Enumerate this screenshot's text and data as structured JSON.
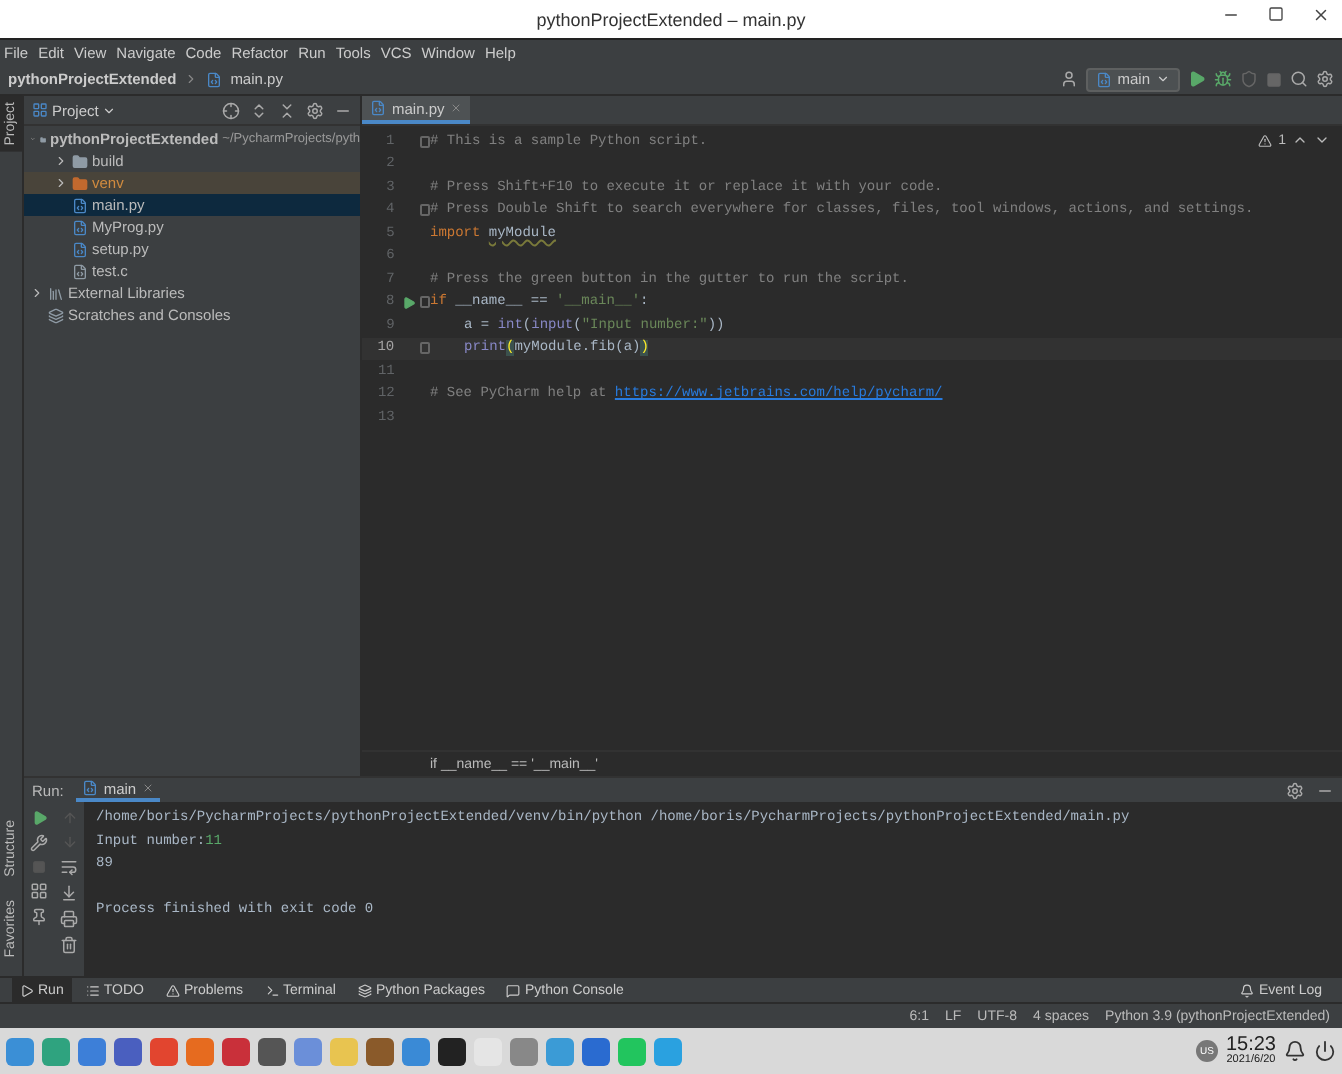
{
  "window": {
    "title": "pythonProjectExtended – main.py"
  },
  "menu": [
    "File",
    "Edit",
    "View",
    "Navigate",
    "Code",
    "Refactor",
    "Run",
    "Tools",
    "VCS",
    "Window",
    "Help"
  ],
  "breadcrumb": [
    "pythonProjectExtended",
    "main.py"
  ],
  "run_config": {
    "label": "main"
  },
  "stripe_top": [
    {
      "label": "Project",
      "selected": true
    }
  ],
  "stripe_bottom": [
    {
      "label": "Structure",
      "selected": false
    },
    {
      "label": "Favorites",
      "selected": false
    }
  ],
  "project_panel": {
    "title": "Project",
    "tree": [
      {
        "label": "pythonProjectExtended",
        "path": "~/PycharmProjects/pyth",
        "kind": "folder",
        "expanded": true,
        "selected": false,
        "children": [
          {
            "label": "build",
            "kind": "folder",
            "expanded": false,
            "selected": false
          },
          {
            "label": "venv",
            "kind": "excluded",
            "expanded": false,
            "selected": false
          },
          {
            "label": "main.py",
            "kind": "python",
            "selected": true
          },
          {
            "label": "MyProg.py",
            "kind": "python",
            "selected": false
          },
          {
            "label": "setup.py",
            "kind": "python",
            "selected": false
          },
          {
            "label": "test.c",
            "kind": "c",
            "selected": false
          }
        ]
      },
      {
        "label": "External Libraries",
        "kind": "libraries",
        "expanded": false,
        "selected": false
      },
      {
        "label": "Scratches and Consoles",
        "kind": "scratches",
        "selected": false
      }
    ]
  },
  "editor": {
    "tabs": [
      {
        "label": "main.py",
        "selected": true
      }
    ],
    "warnings": "1",
    "breadcrumb": "if __name__ == '__main__'",
    "lines": [
      {
        "number": "1",
        "fold": true,
        "run": false,
        "current": false,
        "indented": false,
        "tokens": [
          {
            "text": "# This is a sample Python script.",
            "kind": "comment"
          }
        ]
      },
      {
        "number": "2",
        "fold": false,
        "run": false,
        "current": false
      },
      {
        "number": "3",
        "fold": false,
        "run": false,
        "current": false,
        "indented": false,
        "tokens": [
          {
            "text": "# Press Shift+F10 to execute it or replace it with your code.",
            "kind": "comment"
          }
        ]
      },
      {
        "number": "4",
        "fold": true,
        "run": false,
        "current": false,
        "indented": false,
        "tokens": [
          {
            "text": "# Press Double Shift to search everywhere for classes, files, tool windows, actions, and settings.",
            "kind": "comment"
          }
        ]
      },
      {
        "number": "5",
        "fold": false,
        "run": false,
        "current": false,
        "indented": false,
        "tokens": [
          {
            "text": "import ",
            "kind": "keyword"
          },
          {
            "text": "myModule",
            "kind": "module"
          }
        ]
      },
      {
        "number": "6",
        "fold": false,
        "run": false,
        "current": false
      },
      {
        "number": "7",
        "fold": false,
        "run": false,
        "current": false,
        "indented": false,
        "tokens": [
          {
            "text": "# Press the green button in the gutter to run the script.",
            "kind": "comment"
          }
        ]
      },
      {
        "number": "8",
        "fold": true,
        "run": true,
        "current": false,
        "indented": false,
        "tokens": [
          {
            "text": "if ",
            "kind": "keyword"
          },
          {
            "text": "__name__ == ",
            "kind": "plain"
          },
          {
            "text": "'__main__'",
            "kind": "string"
          },
          {
            "text": ":",
            "kind": "plain"
          }
        ]
      },
      {
        "number": "9",
        "fold": false,
        "run": false,
        "current": false,
        "indented": true,
        "tokens": [
          {
            "text": "a = ",
            "kind": "plain"
          },
          {
            "text": "int",
            "kind": "builtin"
          },
          {
            "text": "(",
            "kind": "plain"
          },
          {
            "text": "input",
            "kind": "builtin"
          },
          {
            "text": "(",
            "kind": "plain"
          },
          {
            "text": "\"Input number:\"",
            "kind": "string"
          },
          {
            "text": "))",
            "kind": "plain"
          }
        ]
      },
      {
        "number": "10",
        "fold": true,
        "run": false,
        "current": true,
        "indented": true,
        "tokens": [
          {
            "text": "print",
            "kind": "builtin"
          },
          {
            "text": "(",
            "kind": "brace"
          },
          {
            "text": "myModule.fib(a)",
            "kind": "plain"
          },
          {
            "text": ")",
            "kind": "brace"
          }
        ]
      },
      {
        "number": "11",
        "fold": false,
        "run": false,
        "current": false
      },
      {
        "number": "12",
        "fold": false,
        "run": false,
        "current": false,
        "indented": false,
        "tokens": [
          {
            "text": "# See PyCharm help at ",
            "kind": "comment"
          },
          {
            "text": "https://www.jetbrains.com/help/pycharm/",
            "kind": "link"
          }
        ]
      },
      {
        "number": "13",
        "fold": false,
        "run": false,
        "current": false
      }
    ]
  },
  "run_panel": {
    "label": "Run:",
    "tabs": [
      {
        "label": "main",
        "selected": true
      }
    ],
    "blocks": [
      {
        "lines": [
          {
            "tokens": [
              {
                "text": "/home/boris/PycharmProjects/pythonProjectExtended/venv/bin/python /home/boris/PycharmProjects/pythonProjectExtended/main.py",
                "kind": "plain"
              }
            ]
          },
          {
            "tokens": [
              {
                "text": "Input number:",
                "kind": "plain"
              },
              {
                "text": "11",
                "kind": "input"
              }
            ]
          },
          {
            "tokens": [
              {
                "text": "89",
                "kind": "plain"
              }
            ]
          }
        ]
      },
      {
        "lines": [
          {
            "tokens": [
              {
                "text": "Process finished with exit code 0",
                "kind": "plain"
              }
            ]
          }
        ]
      }
    ]
  },
  "tool_tabs": [
    {
      "label": "Run",
      "selected": true
    },
    {
      "label": "TODO",
      "selected": false
    },
    {
      "label": "Problems",
      "selected": false
    },
    {
      "label": "Terminal",
      "selected": false
    },
    {
      "label": "Python Packages",
      "selected": false
    },
    {
      "label": "Python Console",
      "selected": false
    }
  ],
  "event_log": "Event Log",
  "status_bar": [
    "6:1",
    "LF",
    "UTF-8",
    "4 spaces",
    "Python 3.9 (pythonProjectExtended)"
  ],
  "taskbar": {
    "keyboard": "US",
    "time": "15:23",
    "date": "2021/6/20"
  }
}
